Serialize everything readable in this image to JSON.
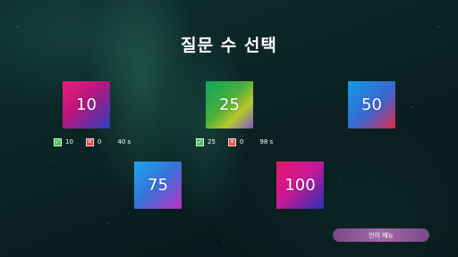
{
  "title": "질문 수 선택",
  "tiles": [
    {
      "label": "10"
    },
    {
      "label": "25"
    },
    {
      "label": "50"
    },
    {
      "label": "75"
    },
    {
      "label": "100"
    }
  ],
  "stats": [
    {
      "tile": "10",
      "correct": "10",
      "wrong": "0",
      "time": "40 s"
    },
    {
      "tile": "25",
      "correct": "25",
      "wrong": "0",
      "time": "98 s"
    }
  ],
  "icons": {
    "correct": "check-icon",
    "wrong": "x-icon",
    "check_glyph": "✓",
    "x_glyph": "✕"
  },
  "menu_button": {
    "label": "언어 메뉴"
  },
  "colors": {
    "background": "#0b2424",
    "correct_green": "#4bbf5a",
    "wrong_red": "#e14848",
    "menu_purple": "#a46aa8"
  }
}
